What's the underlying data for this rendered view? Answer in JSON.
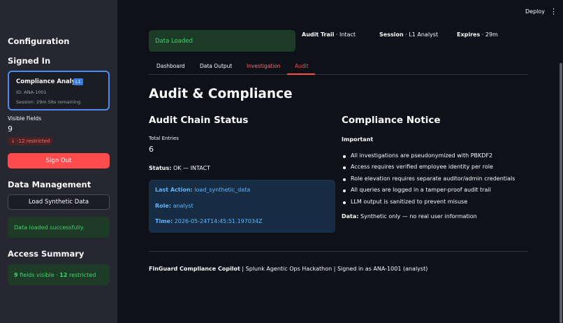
{
  "header": {
    "deploy_label": "Deploy",
    "menu_glyph": "⋮"
  },
  "sidebar": {
    "config_title": "Configuration",
    "signed_in_title": "Signed In",
    "user": {
      "role": "Compliance Analyst",
      "badge": "L1",
      "id": "ID: ANA-1001",
      "session": "Session: 29m 56s remaining"
    },
    "visible_fields": {
      "label": "Visible Fields",
      "value": "9",
      "delta": "-12 restricted"
    },
    "sign_out_label": "Sign Out",
    "data_mgmt_title": "Data Management",
    "load_label": "Load Synthetic Data",
    "load_success": "Data loaded successfully.",
    "access_title": "Access Summary",
    "access": {
      "visible_count": "9",
      "visible_text": " fields visible · ",
      "restricted_count": "12",
      "restricted_text": " restricted"
    }
  },
  "main": {
    "data_loaded": "Data Loaded",
    "audit_trail": {
      "label": "Audit Trail",
      "value": " · Intact"
    },
    "session": {
      "label": "Session",
      "value": " · L1 Analyst"
    },
    "expires": {
      "label": "Expires",
      "value": " · 29m"
    },
    "tabs": [
      {
        "label": "Dashboard"
      },
      {
        "label": "Data Output"
      },
      {
        "label": "Investigation"
      },
      {
        "label": "Audit"
      }
    ],
    "title": "Audit & Compliance",
    "chain": {
      "title": "Audit Chain Status",
      "total_label": "Total Entries",
      "total_value": "6",
      "status_label": "Status:",
      "status_value": " OK — INTACT",
      "last_action_label": "Last Action:",
      "last_action_value": " load_synthetic_data",
      "role_label": "Role:",
      "role_value": " analyst",
      "time_label": "Time:",
      "time_value": " 2026-05-24T14:45:51.197034Z"
    },
    "notice": {
      "title": "Compliance Notice",
      "important": "Important",
      "items": [
        "All investigations are pseudonymized with PBKDF2",
        "Access requires verified employee identity per role",
        "Role elevation requires separate auditor/admin credentials",
        "All queries are logged in a tamper-proof audit trail",
        "LLM output is sanitized to prevent misuse"
      ],
      "data_label": "Data:",
      "data_value": " Synthetic only — no real user information"
    },
    "footer": {
      "brand": "FinGuard Compliance Copilot",
      "rest": " | Splunk Agentic Ops Hackathon | Signed in as ANA-1001 (analyst)"
    }
  }
}
